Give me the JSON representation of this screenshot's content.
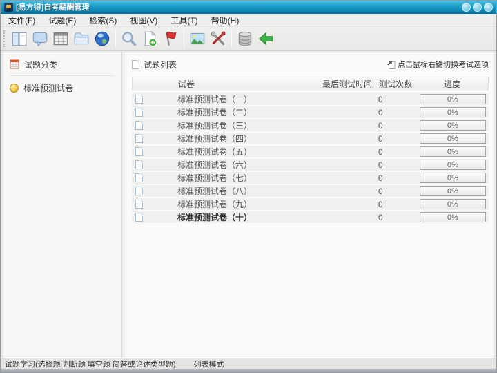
{
  "window": {
    "title": "[易方得]自考薪酬管理",
    "controls": {
      "minimize": "─",
      "maximize": "▫",
      "close": "✕"
    }
  },
  "menu": {
    "items": [
      "文件(F)",
      "试题(E)",
      "检索(S)",
      "视图(V)",
      "工具(T)",
      "帮助(H)"
    ]
  },
  "toolbar": {
    "icons": [
      "open-book",
      "comment",
      "calendar",
      "folder",
      "globe",
      "search",
      "add-page",
      "flag",
      "image",
      "tools",
      "database",
      "back-arrow"
    ]
  },
  "sidebar": {
    "header": "试题分类",
    "items": [
      {
        "label": "标准预测试卷"
      }
    ]
  },
  "main": {
    "header": "试题列表",
    "hint": "点击鼠标右键切换考试选项",
    "table": {
      "columns": [
        "试卷",
        "最后测试时间",
        "测试次数",
        "进度"
      ],
      "rows": [
        {
          "name": "标准预测试卷（一）",
          "last_test_time": "",
          "test_count": "0",
          "progress": "0%"
        },
        {
          "name": "标准预测试卷（二）",
          "last_test_time": "",
          "test_count": "0",
          "progress": "0%"
        },
        {
          "name": "标准预测试卷（三）",
          "last_test_time": "",
          "test_count": "0",
          "progress": "0%"
        },
        {
          "name": "标准预测试卷（四）",
          "last_test_time": "",
          "test_count": "0",
          "progress": "0%"
        },
        {
          "name": "标准预测试卷（五）",
          "last_test_time": "",
          "test_count": "0",
          "progress": "0%"
        },
        {
          "name": "标准预测试卷（六）",
          "last_test_time": "",
          "test_count": "0",
          "progress": "0%"
        },
        {
          "name": "标准预测试卷（七）",
          "last_test_time": "",
          "test_count": "0",
          "progress": "0%"
        },
        {
          "name": "标准预测试卷（八）",
          "last_test_time": "",
          "test_count": "0",
          "progress": "0%"
        },
        {
          "name": "标准预测试卷（九）",
          "last_test_time": "",
          "test_count": "0",
          "progress": "0%"
        },
        {
          "name": "标准预测试卷（十）",
          "last_test_time": "",
          "test_count": "0",
          "progress": "0%",
          "bold": true
        }
      ]
    }
  },
  "statusbar": {
    "left": "试题学习(选择题 判断题 填空题 简答或论述类型题)",
    "right": "列表模式"
  },
  "colors": {
    "titlebar_top": "#4fc1e2",
    "titlebar_bottom": "#0d81b0",
    "flag_red": "#d63333",
    "back_green": "#3cb44a"
  }
}
